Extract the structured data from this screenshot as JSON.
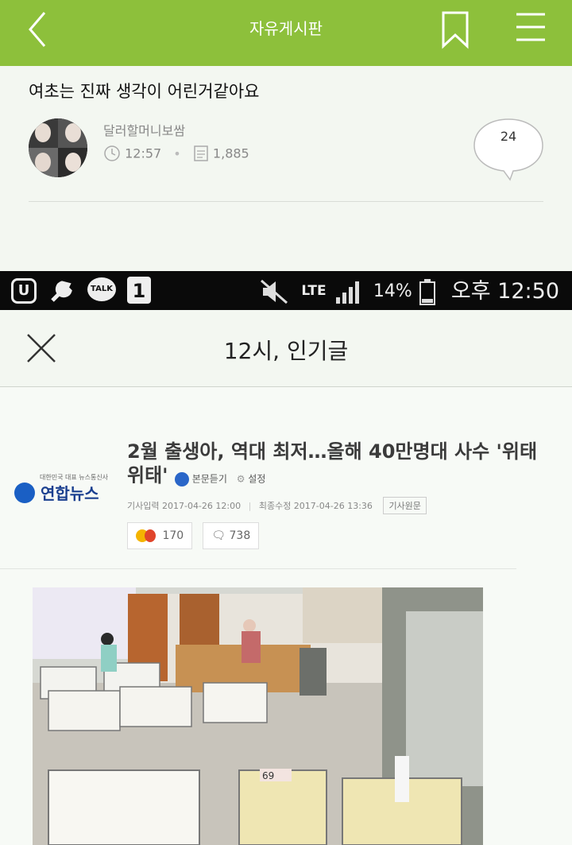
{
  "topbar": {
    "title": "자유게시판",
    "accent_color": "#8dc03b",
    "icons": [
      "back-arrow-icon",
      "bookmark-icon",
      "menu-icon"
    ]
  },
  "post": {
    "title": "여초는 진짜 생각이 어린거같아요",
    "author": "달러할머니보쌈",
    "time": "12:57",
    "views": "1,885",
    "comment_count": "24"
  },
  "status_bar": {
    "network": "LTE",
    "battery": "14%",
    "time": "오후 12:50",
    "icons": [
      "u-plus-icon",
      "wrench-icon",
      "talk-icon",
      "one-store-icon",
      "mute-icon",
      "signal-icon",
      "battery-icon"
    ]
  },
  "popular": {
    "title": "12시, 인기글"
  },
  "article": {
    "source": "연합뉴스",
    "source_tagline": "대한민국 대표 뉴스통신사",
    "headline": "2월 출생아, 역대 최저…올해 40만명대 사수 '위태위태'",
    "listen_label": "본문듣기",
    "settings_label": "설정",
    "input_date": "기사입력 2017-04-26 12:00",
    "modified_date": "최종수정 2017-04-26 13:36",
    "original_label": "기사원문",
    "reaction_count": "170",
    "comment_count": "738",
    "photo_label": "69"
  }
}
